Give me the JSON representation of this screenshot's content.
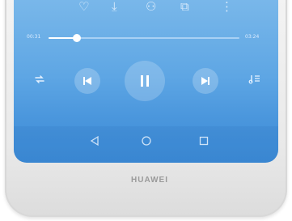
{
  "actions": [
    {
      "icon": "heart-outline-icon",
      "glyph": "♡"
    },
    {
      "icon": "download-icon",
      "glyph": "⤓"
    },
    {
      "icon": "share-icon",
      "glyph": "⚇"
    },
    {
      "icon": "queue-add-icon",
      "glyph": "⧉"
    },
    {
      "icon": "more-vertical-icon",
      "glyph": "⋮"
    }
  ],
  "progress": {
    "elapsed": "00:31",
    "total": "03:24",
    "fraction": 0.15
  },
  "controls": {
    "repeat_icon": "repeat-icon",
    "prev_icon": "skip-previous-icon",
    "pause_icon": "pause-icon",
    "next_icon": "skip-next-icon",
    "playlist_icon": "playlist-icon"
  },
  "nav": {
    "back_icon": "back-triangle-icon",
    "home_icon": "home-circle-icon",
    "recent_icon": "recents-square-icon"
  },
  "brand": "HUAWEI",
  "colors": {
    "screen_top": "#7ab8ea",
    "screen_bottom": "#3e8cd6",
    "accent": "#ffffff"
  }
}
